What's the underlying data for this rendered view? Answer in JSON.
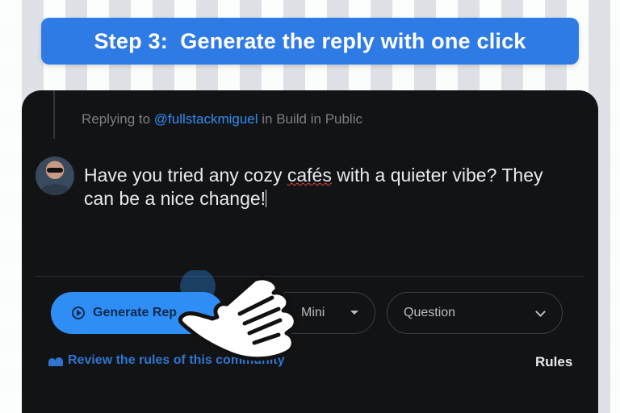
{
  "banner": {
    "title": "Step 3:  Generate the reply with one click"
  },
  "reply": {
    "prefix": "Replying to ",
    "handle": "@fullstackmiguel",
    "suffix": " in Build in Public"
  },
  "compose": {
    "text_before": "Have you tried any cozy ",
    "misspelled": "cafés",
    "text_after": " with a quieter vibe? They can be a nice change!"
  },
  "toolbar": {
    "generate_label": "Generate Rep",
    "model_value": "Mini",
    "tone_value": "Question"
  },
  "footer": {
    "rules_link": "Review the rules of this community",
    "rules_tab": "Rules"
  },
  "colors": {
    "accent": "#2f8ef5",
    "banner": "#2f7be6",
    "panel": "#121315"
  }
}
